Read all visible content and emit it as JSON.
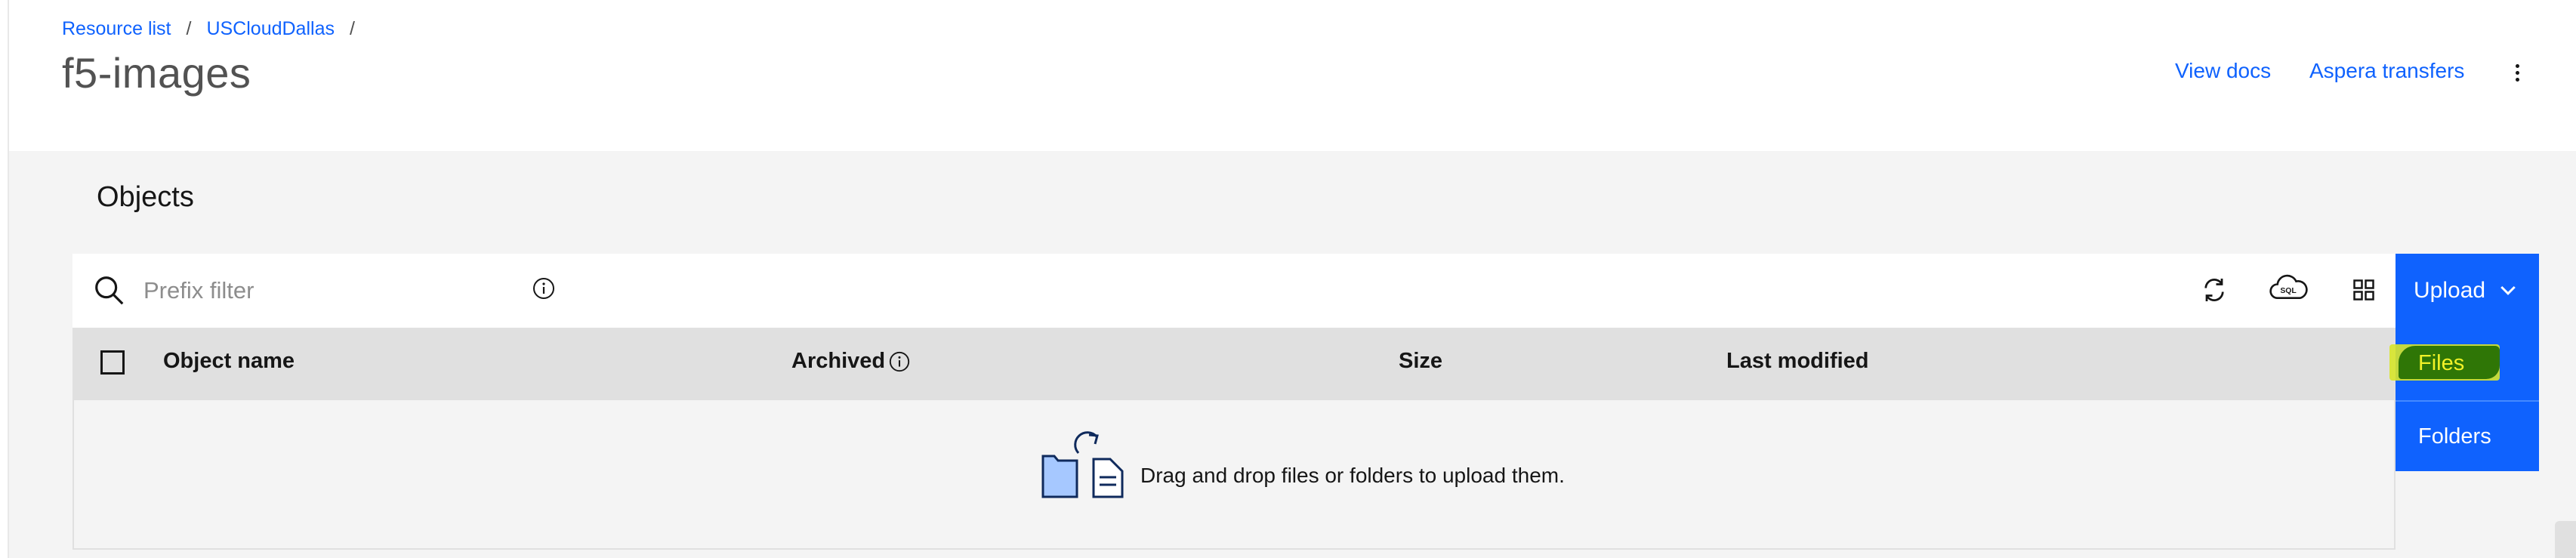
{
  "breadcrumb": {
    "items": [
      "Resource list",
      "USCloudDallas"
    ],
    "separator": "/"
  },
  "page": {
    "title": "f5-images"
  },
  "header_actions": {
    "view_docs": "View docs",
    "aspera": "Aspera transfers"
  },
  "section": {
    "title": "Objects"
  },
  "toolbar": {
    "filter_placeholder": "Prefix filter",
    "upload_label": "Upload"
  },
  "table": {
    "columns": [
      "Object name",
      "Archived",
      "Size",
      "Last modified"
    ]
  },
  "empty_state": {
    "text": "Drag and drop files or folders to upload them."
  },
  "upload_menu": {
    "items": [
      "Files",
      "Folders"
    ]
  },
  "colors": {
    "primary": "#0f62fe",
    "page_bg": "#f4f4f4",
    "table_header": "#e0e0e0",
    "highlight_yellow": "#d7e62a",
    "highlight_green": "#1f6b00"
  },
  "icons": [
    "search-icon",
    "info-icon",
    "refresh-icon",
    "cloud-sql-icon",
    "grid-view-icon",
    "chevron-down-icon",
    "overflow-menu-icon",
    "upload-illustration-icon"
  ]
}
